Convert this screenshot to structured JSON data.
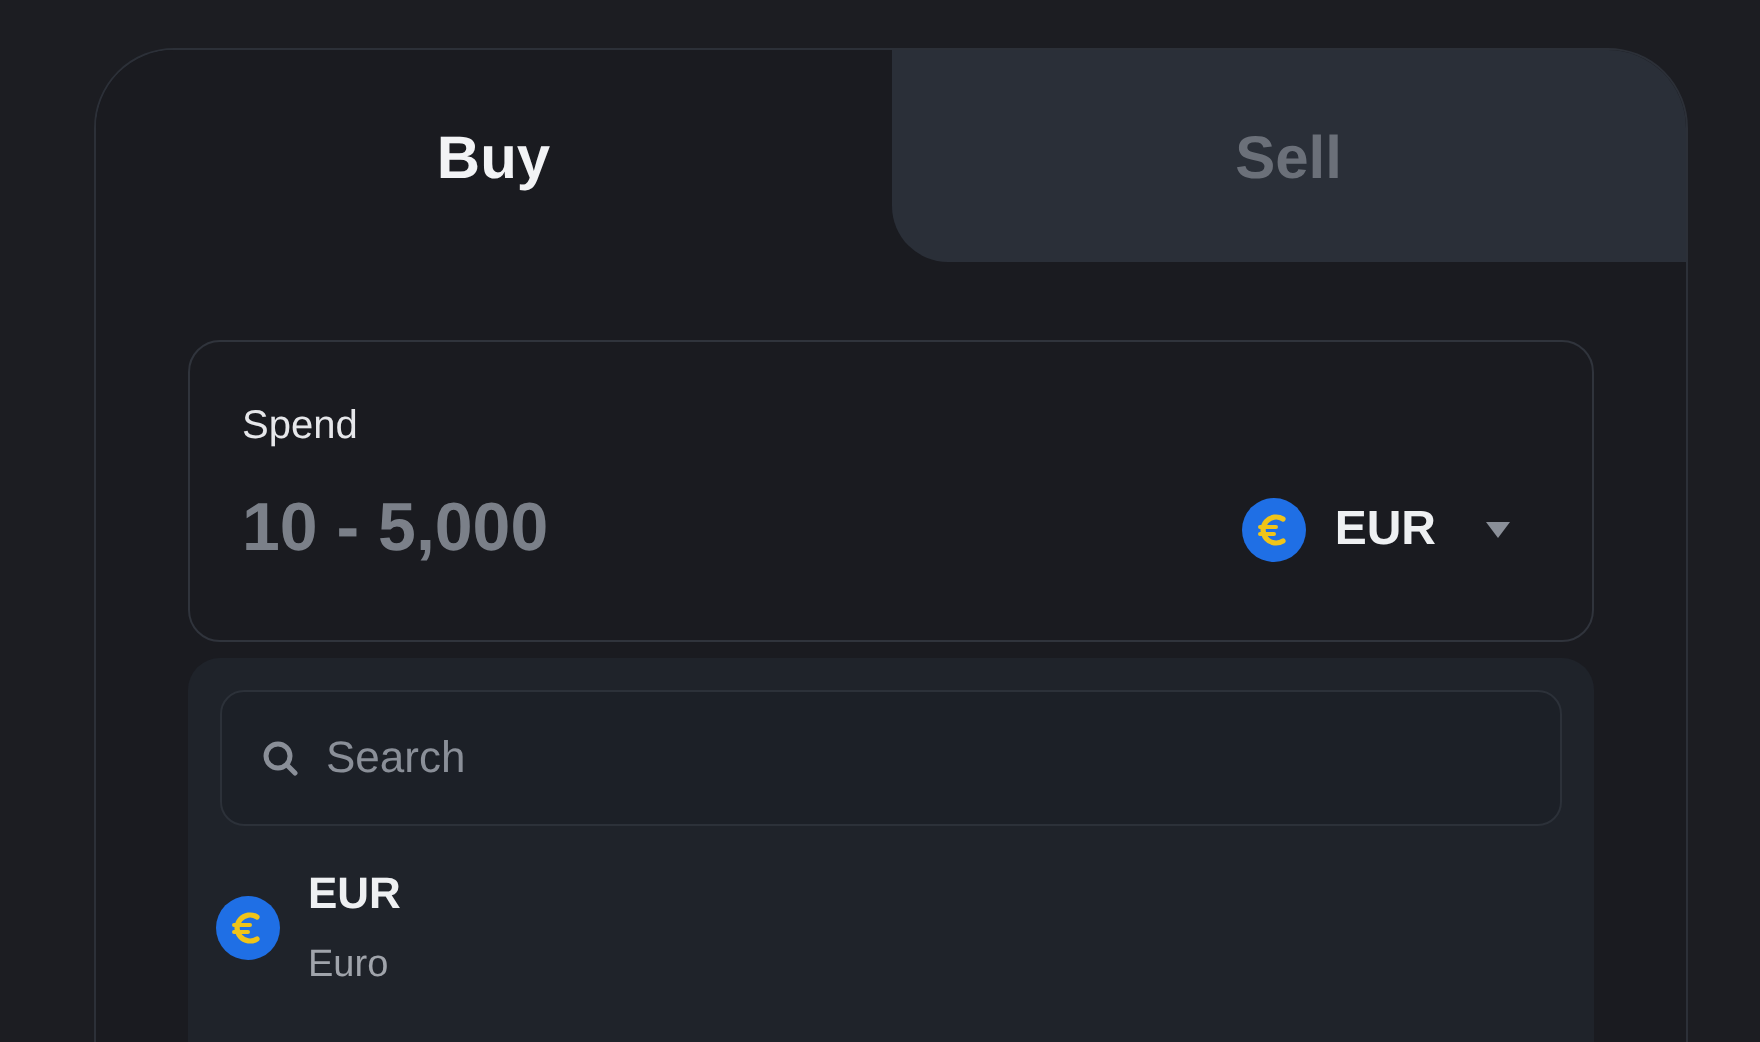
{
  "tabs": [
    {
      "label": "Buy",
      "selected": true
    },
    {
      "label": "Sell",
      "selected": false
    }
  ],
  "spend": {
    "label": "Spend",
    "placeholder": "10 - 5,000",
    "currency": "EUR"
  },
  "dropdown": {
    "search": {
      "placeholder": "Search"
    },
    "items": [
      {
        "code": "EUR",
        "name": "Euro"
      }
    ]
  }
}
